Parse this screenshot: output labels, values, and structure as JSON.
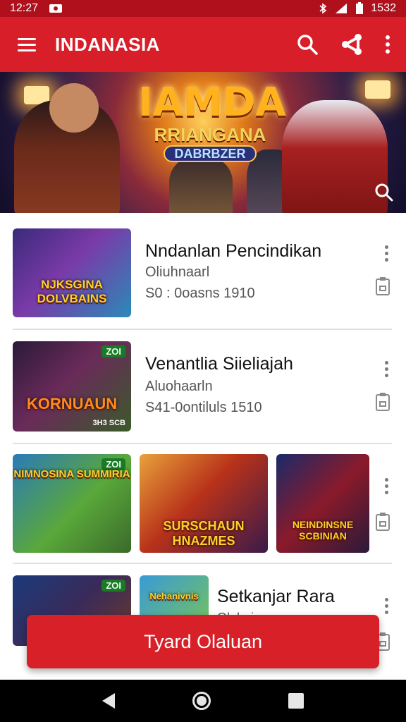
{
  "status_bar": {
    "time": "12:27",
    "battery": "1532"
  },
  "app_bar": {
    "title": "INDANASIA"
  },
  "banner": {
    "title": "IAMDA",
    "subtitle": "RRIANGANA",
    "badge": "DABRBZER"
  },
  "items": [
    {
      "title": "Nndanlan Pencindikan",
      "sub1": "Oliuhnaarl",
      "sub2": "S0 : 0oasns 1910",
      "thumb_text": "NJKSGINA DOLVBAINS"
    },
    {
      "title": "Venantlia Siieliajah",
      "sub1": "Aluohaarln",
      "sub2": "S41-0ontiluls 1510",
      "thumb_text": "KORNUAUN",
      "thumb_badge": "ZOI",
      "thumb_corner": "3H3 SCB"
    },
    {
      "thumbs": [
        {
          "text": "NIMNOSINA SUMMIRIA",
          "badge": "ZOI"
        },
        {
          "text": "SURSCHAUN HNAZMES"
        },
        {
          "text": "NEINDINSNE SCBINIAN"
        }
      ]
    },
    {
      "title": "Setkanjar Rara",
      "sub1": "Olohnian",
      "thumbs": [
        {
          "badge": "ZOI"
        },
        {
          "text": "Nehanivnis"
        }
      ]
    }
  ],
  "cta": {
    "label": "Tyard Olaluan"
  },
  "colors": {
    "primary": "#d81e28",
    "status": "#b0101c",
    "text": "#111111",
    "muted": "#555555"
  }
}
